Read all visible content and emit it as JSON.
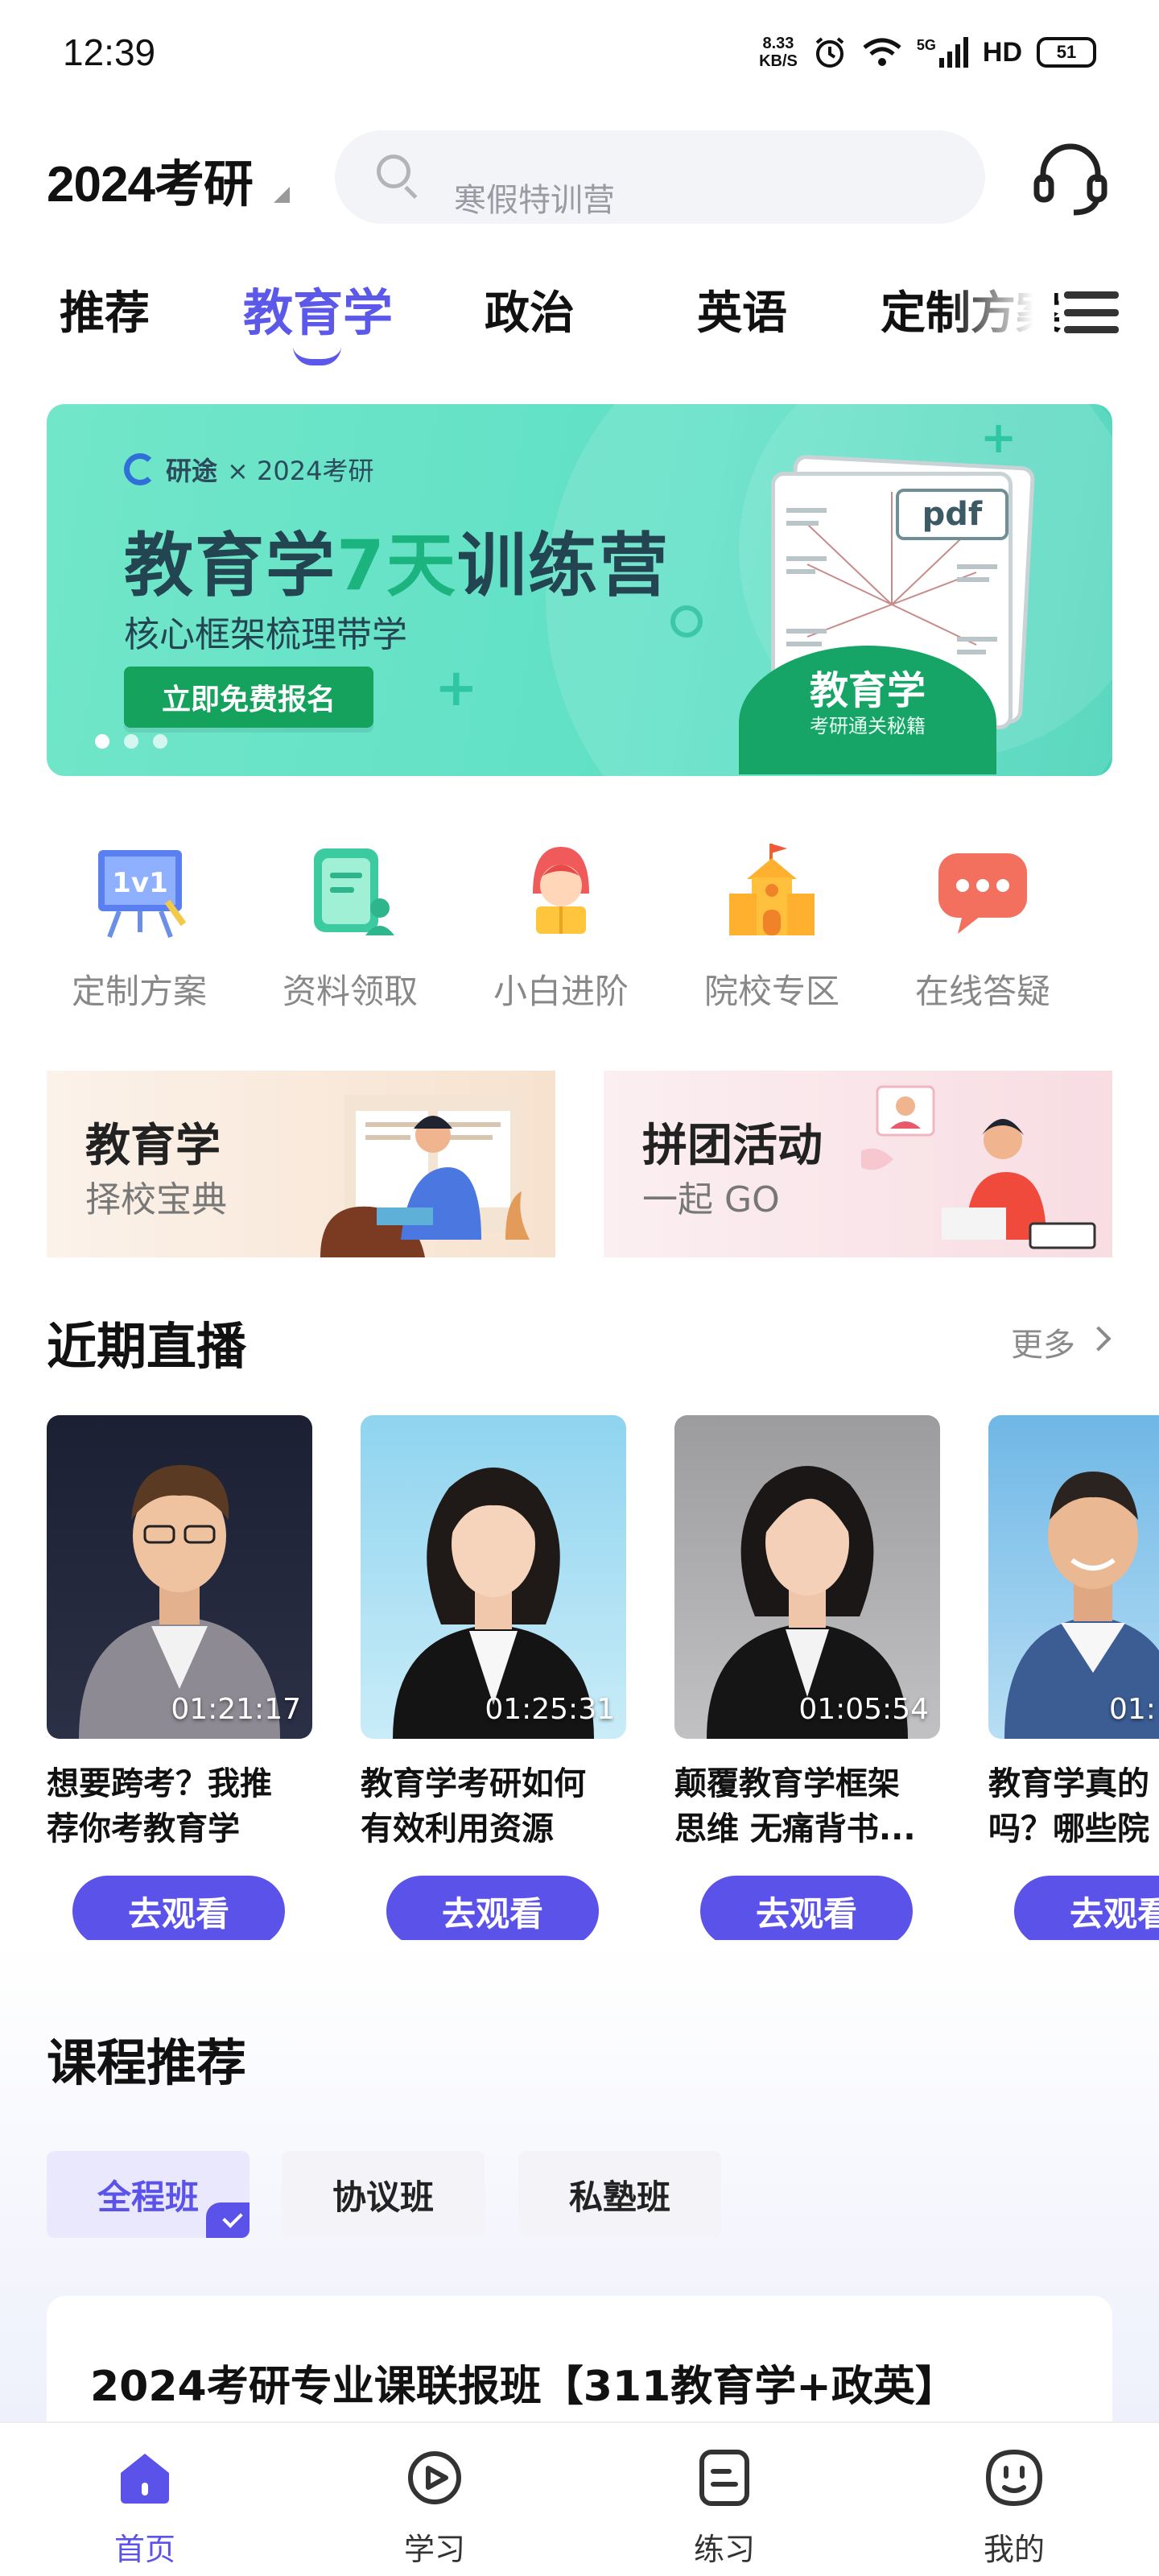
{
  "status_bar": {
    "time": "12:39",
    "net_speed_value": "8.33",
    "net_speed_unit": "KB/S",
    "network": "5G",
    "hd": "HD",
    "battery": "51"
  },
  "header": {
    "year_select": "2024考研",
    "search_placeholder": "寒假特训营"
  },
  "tabs": [
    {
      "label": "推荐"
    },
    {
      "label": "教育学"
    },
    {
      "label": "政治"
    },
    {
      "label": "英语"
    },
    {
      "label": "定制方案"
    }
  ],
  "active_tab": "教育学",
  "banner": {
    "brand_name": "研途",
    "brand_collab": "× 2024考研",
    "title_part1": "教育学",
    "title_highlight": "7天",
    "title_part2": "训练营",
    "subtitle": "核心框架梳理带学",
    "button": "立即免费报名",
    "pdf_tag": "pdf",
    "book_title": "教育学",
    "book_subtitle": "考研通关秘籍",
    "dots_count": 3,
    "active_dot": 1,
    "colors": {
      "bg": "#5fe0c6",
      "button": "#15a25c",
      "highlight": "#1bb47e"
    }
  },
  "quick_entries": [
    {
      "label": "定制方案",
      "icon": "whiteboard-1v1-icon"
    },
    {
      "label": "资料领取",
      "icon": "document-icon"
    },
    {
      "label": "小白进阶",
      "icon": "student-reading-icon"
    },
    {
      "label": "院校专区",
      "icon": "school-building-icon"
    },
    {
      "label": "在线答疑",
      "icon": "chat-bubble-icon"
    }
  ],
  "promos": [
    {
      "title": "教育学",
      "subtitle": "择校宝典"
    },
    {
      "title": "拼团活动",
      "subtitle": "一起 GO"
    }
  ],
  "live_section": {
    "title": "近期直播",
    "more": "更多",
    "items": [
      {
        "title_line1": "想要跨考？我推",
        "title_line2": "荐你考教育学",
        "duration": "01:21:17",
        "button": "去观看"
      },
      {
        "title_line1": "教育学考研如何",
        "title_line2": "有效利用资源",
        "duration": "01:25:31",
        "button": "去观看"
      },
      {
        "title_line1": "颠覆教育学框架",
        "title_line2": "思维 无痛背书...",
        "duration": "01:05:54",
        "button": "去观看"
      },
      {
        "title_line1": "教育学真的",
        "title_line2": "吗？哪些院",
        "duration": "01:",
        "button": "去观看"
      }
    ]
  },
  "course_section": {
    "title": "课程推荐",
    "tabs": [
      "全程班",
      "协议班",
      "私塾班"
    ],
    "active_tab": "全程班",
    "first_course_title": "2024考研专业课联报班【311教育学+政英】"
  },
  "bottom_nav": [
    {
      "label": "首页",
      "icon": "home-icon"
    },
    {
      "label": "学习",
      "icon": "play-circle-icon"
    },
    {
      "label": "练习",
      "icon": "exercise-doc-icon"
    },
    {
      "label": "我的",
      "icon": "profile-face-icon"
    }
  ],
  "active_nav": "首页",
  "accent_color": "#5b52ea"
}
